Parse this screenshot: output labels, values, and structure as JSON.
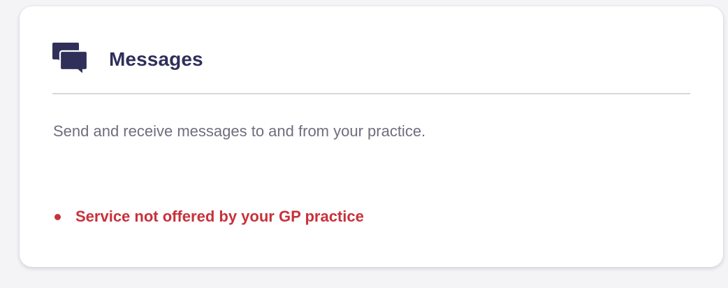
{
  "card": {
    "title": "Messages",
    "icon": "speech-bubbles-icon",
    "description": "Send and receive messages to and from your practice.",
    "status": {
      "text": "Service not offered by your GP practice",
      "color": "#c8313b"
    }
  },
  "colors": {
    "page_background": "#f4f4f6",
    "card_background": "#ffffff",
    "title": "#2f2f5a",
    "icon": "#2f2f5a",
    "description": "#6e6e7e",
    "divider": "#d7d7dd",
    "error": "#c8313b"
  }
}
